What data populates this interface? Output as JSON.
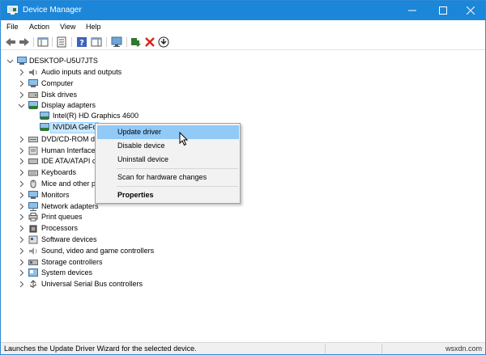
{
  "window": {
    "title": "Device Manager"
  },
  "menu": [
    "File",
    "Action",
    "View",
    "Help"
  ],
  "tree": {
    "root": "DESKTOP-U5U7JTS",
    "categories": [
      "Audio inputs and outputs",
      "Computer",
      "Disk drives",
      "Display adapters",
      "DVD/CD-ROM d",
      "Human Interface",
      "IDE ATA/ATAPI c",
      "Keyboards",
      "Mice and other p",
      "Monitors",
      "Network adapters",
      "Print queues",
      "Processors",
      "Software devices",
      "Sound, video and game controllers",
      "Storage controllers",
      "System devices",
      "Universal Serial Bus controllers"
    ],
    "display_children": [
      "Intel(R) HD Graphics 4600",
      "NVIDIA GeFo"
    ]
  },
  "context_menu": {
    "update_driver": "Update driver",
    "disable_device": "Disable device",
    "uninstall_device": "Uninstall device",
    "scan": "Scan for hardware changes",
    "properties": "Properties"
  },
  "status": {
    "text": "Launches the Update Driver Wizard for the selected device.",
    "watermark": "wsxdn.com"
  },
  "colors": {
    "titlebar": "#1c86d9",
    "highlight": "#91c9f7",
    "selection": "#cce8ff"
  }
}
